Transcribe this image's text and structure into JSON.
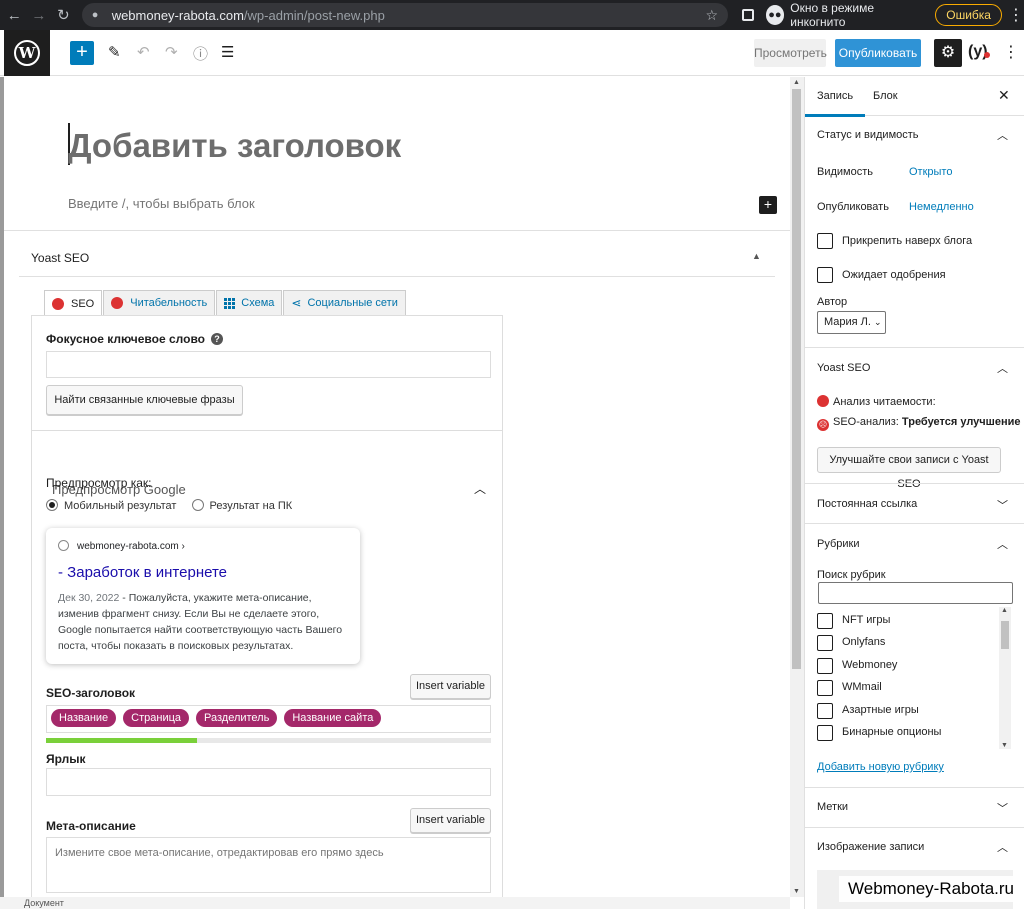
{
  "browser": {
    "url_host": "webmoney-rabota.com",
    "url_path": "/wp-admin/post-new.php",
    "incognito_label": "Окно в режиме инкогнито",
    "error_label": "Ошибка"
  },
  "toolbar": {
    "preview_label": "Просмотреть",
    "publish_label": "Опубликовать",
    "publish_color": "#2f93d6"
  },
  "editor": {
    "title_placeholder": "Добавить заголовок",
    "block_placeholder": "Введите /, чтобы выбрать блок"
  },
  "yoast": {
    "panel_title": "Yoast SEO",
    "tabs": [
      {
        "label": "SEO",
        "icon": "red-dot-icon"
      },
      {
        "label": "Читабельность",
        "icon": "red-dot-icon"
      },
      {
        "label": "Схема",
        "icon": "grid-icon"
      },
      {
        "label": "Социальные сети",
        "icon": "share-icon"
      }
    ],
    "focus_keyword_label": "Фокусное ключевое слово",
    "focus_keyword_value": "",
    "related_button": "Найти связанные ключевые фразы",
    "google_preview_title": "Предпросмотр Google",
    "preview_as_label": "Предпросмотр как:",
    "mobile_option": "Мобильный результат",
    "desktop_option": "Результат на ПК",
    "snippet": {
      "url": "webmoney-rabota.com ›",
      "title": "- Заработок в интернете",
      "date": "Дек 30, 2022",
      "sep": " - ",
      "description": "Пожалуйста, укажите мета-описание, изменив фрагмент снизу. Если Вы не сделаете этого, Google попытается найти соответствующую часть Вашего поста, чтобы показать в поисковых результатах."
    },
    "seo_title_label": "SEO-заголовок",
    "insert_variable": "Insert variable",
    "chips": [
      "Название",
      "Страница",
      "Разделитель",
      "Название сайта"
    ],
    "title_progress": 0.34,
    "slug_label": "Ярлык",
    "slug_value": "",
    "meta_label": "Мета-описание",
    "meta_placeholder": "Измените свое мета-описание, отредактировав его прямо здесь",
    "chip_color": "#a4286a",
    "progress_color": "#7ad03a"
  },
  "sidebar": {
    "tab_post": "Запись",
    "tab_block": "Блок",
    "status_title": "Статус и видимость",
    "visibility_label": "Видимость",
    "visibility_value": "Открыто",
    "publish_label": "Опубликовать",
    "publish_value": "Немедленно",
    "sticky_label": "Прикрепить наверх блога",
    "pending_label": "Ожидает одобрения",
    "author_label": "Автор",
    "author_value": "Мария Л.",
    "yoast_title": "Yoast SEO",
    "readability": "Анализ читаемости:",
    "seo_analysis_prefix": "SEO-анализ: ",
    "seo_analysis_value": "Требуется улучшение",
    "yoast_button": "Улучшайте свои записи с Yoast SEO",
    "permalink_title": "Постоянная ссылка",
    "categories_title": "Рубрики",
    "category_search_label": "Поиск рубрик",
    "categories": [
      "NFT игры",
      "Onlyfans",
      "Webmoney",
      "WMmail",
      "Азартные игры",
      "Бинарные опционы"
    ],
    "add_category": "Добавить новую рубрику",
    "tags_title": "Метки",
    "featured_title": "Изображение записи"
  },
  "statusbar": "Документ",
  "watermark": "Webmoney-Rabota.ru"
}
